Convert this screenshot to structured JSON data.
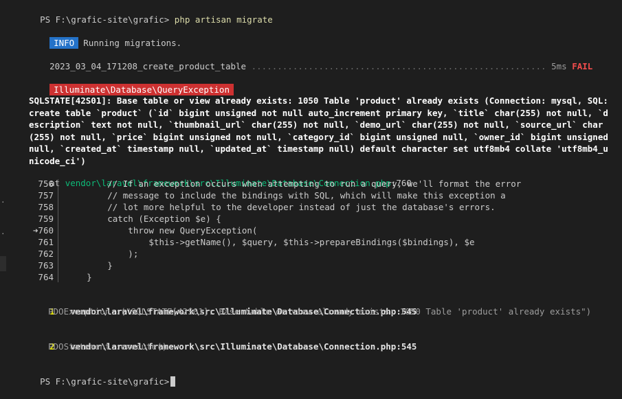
{
  "prompt": {
    "path": "PS F:\\grafic-site\\grafic>",
    "command": "php artisan migrate"
  },
  "info": {
    "badge": "INFO",
    "text": "Running migrations."
  },
  "migration": {
    "name": "2023_03_04_171208_create_product_table",
    "dots": " .........................................................",
    "time": "5ms",
    "status": "FAIL"
  },
  "exception": {
    "name": "Illuminate\\Database\\QueryException"
  },
  "error_message": "SQLSTATE[42S01]: Base table or view already exists: 1050 Table 'product' already exists (Connection: mysql, SQL: create table `product` (`id` bigint unsigned not null auto_increment primary key, `title` char(255) not null, `description` text not null, `thumbnail_url` char(255) not null, `demo_url` char(255) not null, `source_url` char(255) not null, `price` bigint unsigned not null, `category_id` bigint unsigned null, `owner_id` bigint unsigned null, `created_at` timestamp null, `updated_at` timestamp null) default character set utf8mb4 collate 'utf8mb4_unicode_ci')",
  "location": {
    "at": "at",
    "file": "vendor\\laravel\\framework\\src\\Illuminate\\Database\\Connection.php",
    "line": ":760"
  },
  "code_lines": [
    {
      "num": "756",
      "text": "        // If an exception occurs when attempting to run a query, we'll format the error"
    },
    {
      "num": "757",
      "text": "        // message to include the bindings with SQL, which will make this exception a"
    },
    {
      "num": "758",
      "text": "        // lot more helpful to the developer instead of just the database's errors."
    },
    {
      "num": "759",
      "text": "        catch (Exception $e) {"
    },
    {
      "num": "➜760",
      "text": "            throw new QueryException("
    },
    {
      "num": "761",
      "text": "                $this->getName(), $query, $this->prepareBindings($bindings), $e"
    },
    {
      "num": "762",
      "text": "            );"
    },
    {
      "num": "763",
      "text": "        }"
    },
    {
      "num": "764",
      "text": "    }"
    }
  ],
  "trace": [
    {
      "num": "1",
      "path": "vendor\\laravel\\framework\\src\\Illuminate\\Database\\Connection.php:545",
      "detail": "PDOException::(\"SQLSTATE[42S01]: Base table or view already exists: 1050 Table 'product' already exists\")"
    },
    {
      "num": "2",
      "path": "vendor\\laravel\\framework\\src\\Illuminate\\Database\\Connection.php:545",
      "detail": "PDOStatement::execute()"
    }
  ],
  "final_prompt": "PS F:\\grafic-site\\grafic>"
}
